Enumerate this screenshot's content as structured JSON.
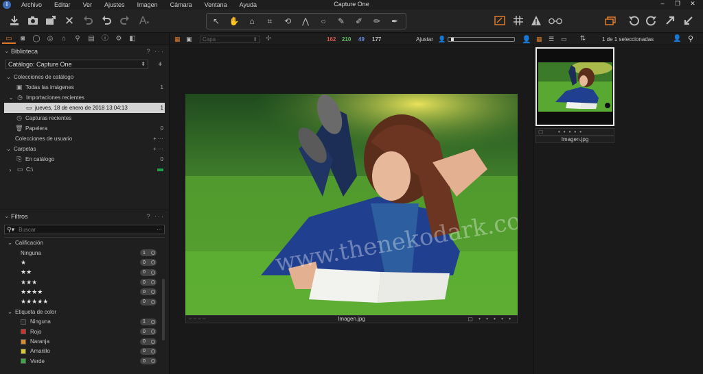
{
  "app": {
    "title": "Capture One",
    "menus": [
      "Archivo",
      "Editar",
      "Ver",
      "Ajustes",
      "Imagen",
      "Cámara",
      "Ventana",
      "Ayuda"
    ],
    "accent_color": "#e07b29"
  },
  "toolbar": {
    "left_icons": [
      "import-icon",
      "camera-capture-icon",
      "export-icon",
      "delete-icon",
      "rotate-undo-icon",
      "undo-icon",
      "redo-icon",
      "text-icon"
    ],
    "cursor_tools": [
      "select-icon",
      "pan-icon",
      "loupe-icon",
      "crop-icon",
      "rotate-icon",
      "keystone-icon",
      "spot-icon",
      "brush-icon",
      "erase-icon",
      "gradient-icon",
      "pick-color-icon"
    ],
    "right_icons": [
      "edit-icon",
      "grid-icon",
      "warning-icon",
      "glasses-icon",
      "stack-icon",
      "rotate-left-icon",
      "rotate-right-icon",
      "expand-icon",
      "collapse-icon"
    ]
  },
  "library": {
    "tool_tab_icons": [
      "folder-icon",
      "camera-icon",
      "lens-icon",
      "color-icon",
      "exposure-icon",
      "search-icon",
      "info-icon",
      "adjust-icon",
      "settings-icon",
      "output-icon"
    ],
    "panel_title": "Biblioteca",
    "catalog_label": "Catálogo: Capture One",
    "catalog_collections": {
      "title": "Colecciones de catálogo",
      "items": [
        {
          "label": "Todas las imágenes",
          "count": "1"
        },
        {
          "label": "Importaciones recientes",
          "count": ""
        },
        {
          "label": "jueves, 18 de enero de 2018 13:04:13",
          "count": "1"
        },
        {
          "label": "Capturas recientes",
          "count": ""
        },
        {
          "label": "Papelera",
          "count": "0"
        }
      ]
    },
    "user_collections": {
      "title": "Colecciones de usuario"
    },
    "folders": {
      "title": "Carpetas",
      "items": [
        {
          "label": "En catálogo",
          "count": "0"
        },
        {
          "label": "C:\\",
          "count": ""
        }
      ]
    }
  },
  "filters": {
    "panel_title": "Filtros",
    "search_placeholder": "Buscar",
    "rating": {
      "title": "Calificación",
      "items": [
        {
          "label": "Ninguna",
          "count": "1"
        },
        {
          "label": "★",
          "count": "0"
        },
        {
          "label": "★★",
          "count": "0"
        },
        {
          "label": "★★★",
          "count": "0"
        },
        {
          "label": "★★★★",
          "count": "0"
        },
        {
          "label": "★★★★★",
          "count": "0"
        }
      ]
    },
    "color_label": {
      "title": "Etiqueta de color",
      "items": [
        {
          "label": "Ninguna",
          "count": "1",
          "color": "#2a2a2a"
        },
        {
          "label": "Rojo",
          "count": "0",
          "color": "#d0302b"
        },
        {
          "label": "Naranja",
          "count": "0",
          "color": "#d98a2b"
        },
        {
          "label": "Amarillo",
          "count": "0",
          "color": "#d8c92f"
        },
        {
          "label": "Verde",
          "count": "0",
          "color": "#3aa844"
        }
      ]
    }
  },
  "viewer_bar": {
    "layer": "Capa",
    "rgb": {
      "r": "162",
      "g": "210",
      "b": "49",
      "l": "177"
    },
    "rgb_colors": {
      "r": "#e0584a",
      "g": "#5fc25a",
      "b": "#6b8ee8",
      "l": "#bbbbbb"
    },
    "fit_label": "Ajustar"
  },
  "viewer": {
    "image_name": "Imagen.jpg",
    "watermark": "www.thenekodark.com"
  },
  "browser_bar": {
    "selection_text": "1 de 1 seleccionadas"
  },
  "browser": {
    "thumb_name": "Imagen.jpg"
  }
}
